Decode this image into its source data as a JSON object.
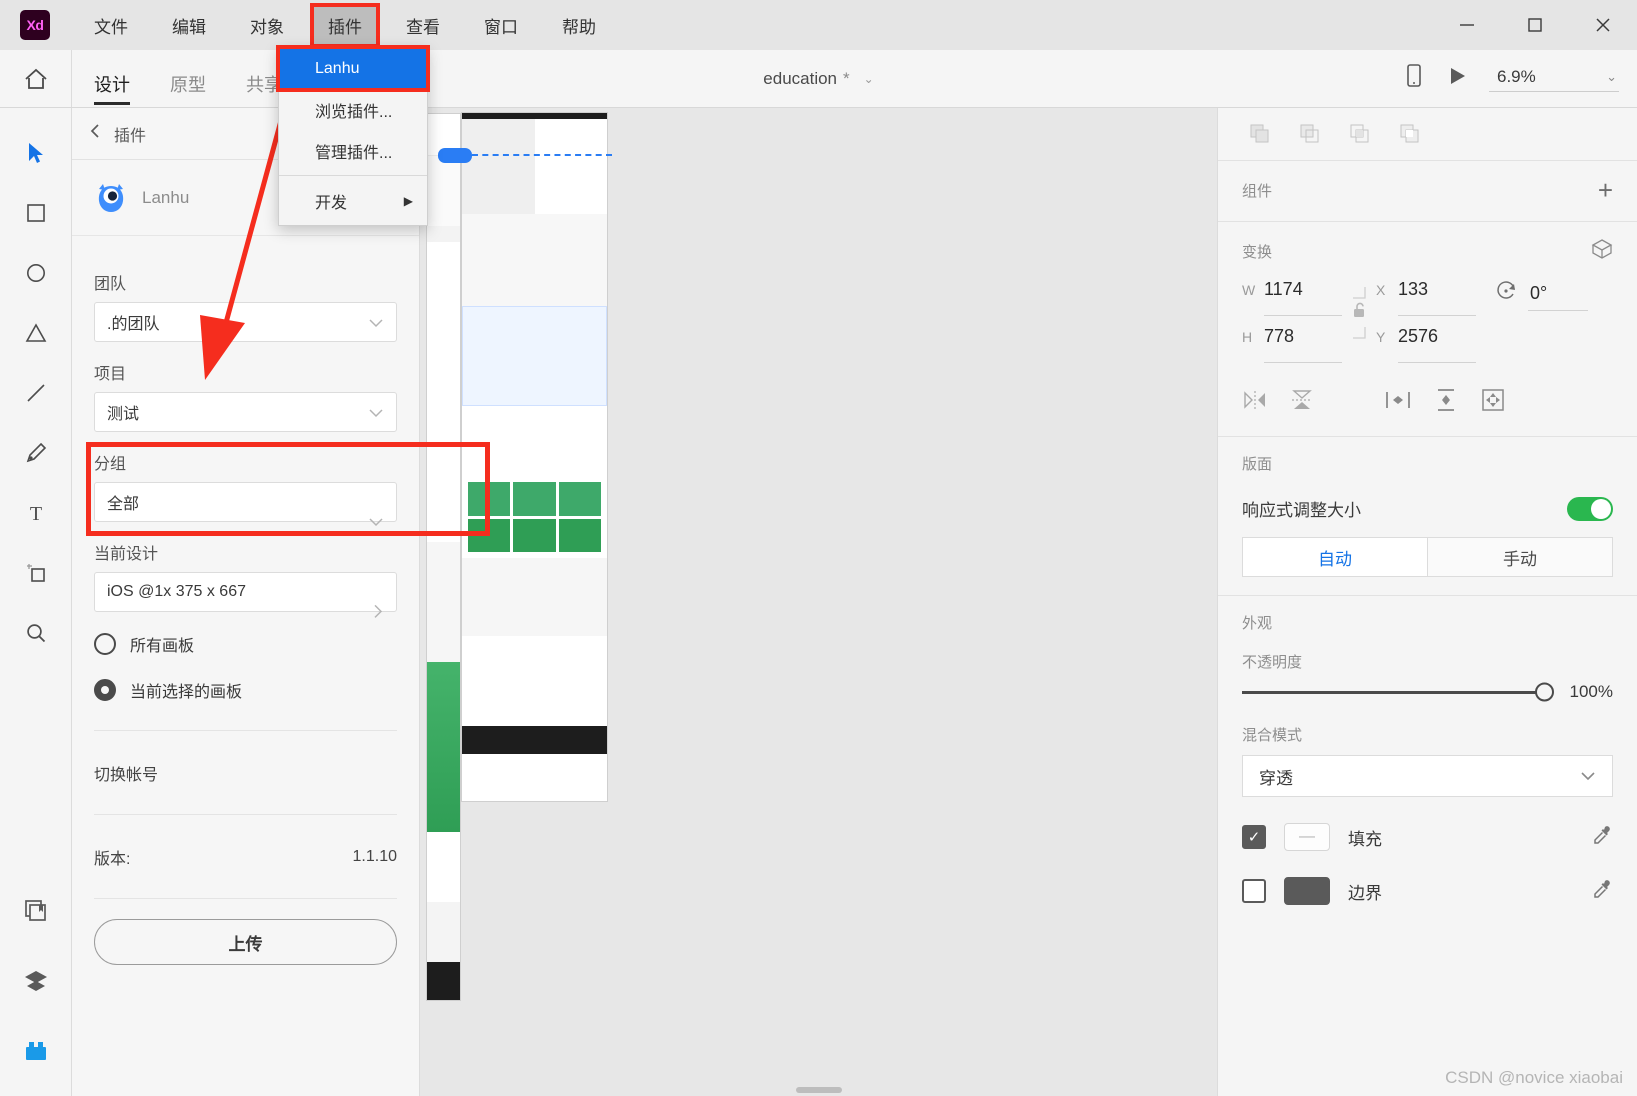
{
  "app": {
    "logo": "Xd",
    "window_controls": [
      "minimize-button",
      "maximize-button",
      "close-button"
    ]
  },
  "menubar": {
    "items": [
      {
        "label": "文件",
        "name": "menu-file",
        "active": false
      },
      {
        "label": "编辑",
        "name": "menu-edit",
        "active": false
      },
      {
        "label": "对象",
        "name": "menu-object",
        "active": false
      },
      {
        "label": "插件",
        "name": "menu-plugins",
        "active": true
      },
      {
        "label": "查看",
        "name": "menu-view",
        "active": false
      },
      {
        "label": "窗口",
        "name": "menu-window",
        "active": false
      },
      {
        "label": "帮助",
        "name": "menu-help",
        "active": false
      }
    ]
  },
  "dropdown": {
    "items": [
      {
        "label": "Lanhu",
        "selected": true,
        "submenu": false
      },
      {
        "label": "浏览插件...",
        "selected": false,
        "submenu": false
      },
      {
        "label": "管理插件...",
        "selected": false,
        "submenu": false
      },
      {
        "label": "开发",
        "selected": false,
        "submenu": true
      }
    ],
    "submenu_arrow": "▶"
  },
  "toolbar": {
    "home_icon": "home-icon",
    "tabs": [
      {
        "label": "设计",
        "active": true
      },
      {
        "label": "原型",
        "active": false
      },
      {
        "label": "共享",
        "active": false
      }
    ],
    "document_title": "education",
    "modified_mark": "*",
    "title_chevron": "⌄",
    "preview_device_icon": "mobile-preview-icon",
    "play_icon": "play-icon",
    "zoom_level": "6.9%",
    "zoom_chevron": "⌄"
  },
  "tool_rail": {
    "tools": [
      {
        "name": "select-tool",
        "label": "选择",
        "active": true
      },
      {
        "name": "rectangle-tool",
        "label": "矩形",
        "active": false
      },
      {
        "name": "ellipse-tool",
        "label": "椭圆",
        "active": false
      },
      {
        "name": "polygon-tool",
        "label": "多边形",
        "active": false
      },
      {
        "name": "line-tool",
        "label": "直线",
        "active": false
      },
      {
        "name": "pen-tool",
        "label": "钢笔",
        "active": false
      },
      {
        "name": "text-tool",
        "label": "文本",
        "active": false
      },
      {
        "name": "artboard-tool",
        "label": "画板",
        "active": false
      },
      {
        "name": "zoom-tool",
        "label": "缩放",
        "active": false
      }
    ],
    "bottom_tools": [
      {
        "name": "libraries-icon",
        "label": "资源库"
      },
      {
        "name": "layers-icon",
        "label": "图层"
      },
      {
        "name": "plugins-icon",
        "label": "插件",
        "active": true
      }
    ]
  },
  "left_panel": {
    "back_label": "插件",
    "back_icon": "chevron-left-icon",
    "plugin_name": "Lanhu",
    "plugin_icon": "lanhu-owl-icon",
    "fields": [
      {
        "label": "团队",
        "value": ".的团队",
        "control": "dropdown",
        "name": "team"
      },
      {
        "label": "项目",
        "value": "测试",
        "control": "dropdown",
        "name": "project",
        "highlighted": true
      },
      {
        "label": "分组",
        "value": "全部",
        "control": "dropdown",
        "name": "group"
      },
      {
        "label": "当前设计",
        "value": "iOS @1x 375 x 667",
        "control": "stepper",
        "name": "current-design"
      }
    ],
    "radios": [
      {
        "label": "所有画板",
        "selected": false
      },
      {
        "label": "当前选择的画板",
        "selected": true
      }
    ],
    "switch_account_label": "切换帐号",
    "version_label": "版本:",
    "version_value": "1.1.10",
    "upload_button": "上传"
  },
  "right_panel": {
    "boolean_ops": [
      "add-shape-icon",
      "subtract-shape-icon",
      "intersect-shape-icon",
      "exclude-overlap-icon"
    ],
    "components": {
      "title": "组件",
      "add_label": "+"
    },
    "transform": {
      "title": "变换",
      "cube_icon": "3d-transform-icon",
      "lock_icon": "unlock-icon",
      "w_key": "W",
      "w_value": "1174",
      "h_key": "H",
      "h_value": "778",
      "x_key": "X",
      "x_value": "133",
      "y_key": "Y",
      "y_value": "2576",
      "rotation_icon": "rotate-icon",
      "rotation_value": "0°",
      "align_icons": [
        "flip-horizontal-icon",
        "flip-vertical-icon",
        "distribute-horizontal-icon",
        "distribute-vertical-icon",
        "resize-to-fit-icon"
      ]
    },
    "layout": {
      "title": "版面",
      "responsive_label": "响应式调整大小",
      "responsive_on": true,
      "segments": [
        {
          "label": "自动",
          "active": true
        },
        {
          "label": "手动",
          "active": false
        }
      ]
    },
    "appearance": {
      "title": "外观",
      "opacity_label": "不透明度",
      "opacity_value": "100%",
      "blend_label": "混合模式",
      "blend_value": "穿透",
      "blend_chevron": "⌄",
      "fill_label": "填充",
      "fill_checked": true,
      "fill_swatch": "mixed",
      "border_label": "边界",
      "border_checked": false,
      "border_color": "#5a5a5a",
      "eyedropper_icon": "eyedropper-icon"
    }
  },
  "canvas": {
    "artboard_name": "education",
    "scroll_thumb": "horizontal-scrollbar"
  },
  "watermark": "CSDN @novice xiaobai",
  "colors": {
    "accent_blue": "#1473e6",
    "annotation_red": "#f52d1e",
    "toggle_green": "#2ab74f",
    "selection_blue": "#2a7df4"
  }
}
